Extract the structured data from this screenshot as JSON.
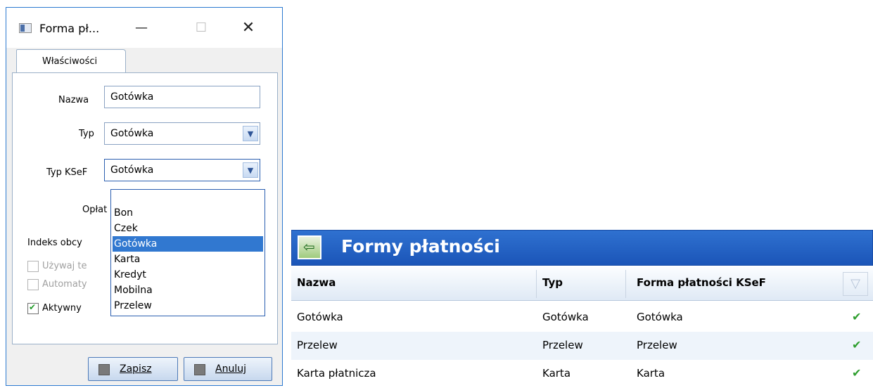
{
  "dialog": {
    "title": "Forma pł...",
    "window_buttons": {
      "minimize": "—",
      "maximize": "☐",
      "close": "✕"
    },
    "tab": "Właściwości",
    "fields": {
      "nazwa": {
        "label": "Nazwa",
        "value": "Gotówka"
      },
      "typ": {
        "label": "Typ",
        "value": "Gotówka"
      },
      "typ_ksef": {
        "label": "Typ KSeF",
        "value": "Gotówka"
      },
      "oplata_label": "Opłat",
      "indeks_label": "Indeks obcy"
    },
    "dropdown_options": [
      "",
      "Bon",
      "Czek",
      "Gotówka",
      "Karta",
      "Kredyt",
      "Mobilna",
      "Przelew"
    ],
    "selected_option": "Gotówka",
    "checkboxes": [
      {
        "label": "Używaj te",
        "checked": false,
        "enabled": false
      },
      {
        "label": "Automaty",
        "checked": false,
        "enabled": false
      },
      {
        "label": "Aktywny",
        "checked": true,
        "enabled": true
      }
    ],
    "buttons": {
      "save": "Zapisz",
      "cancel": "Anuluj"
    }
  },
  "list": {
    "title": "Formy płatności",
    "columns": [
      "Nazwa",
      "Typ",
      "Forma płatności KSeF"
    ],
    "rows": [
      {
        "nazwa": "Gotówka",
        "typ": "Gotówka",
        "ksef": "Gotówka",
        "active": "✔"
      },
      {
        "nazwa": "Przelew",
        "typ": "Przelew",
        "ksef": "Przelew",
        "active": "✔"
      },
      {
        "nazwa": "Karta płatnicza",
        "typ": "Karta",
        "ksef": "Karta",
        "active": "✔"
      }
    ]
  },
  "colors": {
    "accent": "#1b55b8",
    "selection": "#3178d0",
    "check": "#2e9e2e"
  }
}
